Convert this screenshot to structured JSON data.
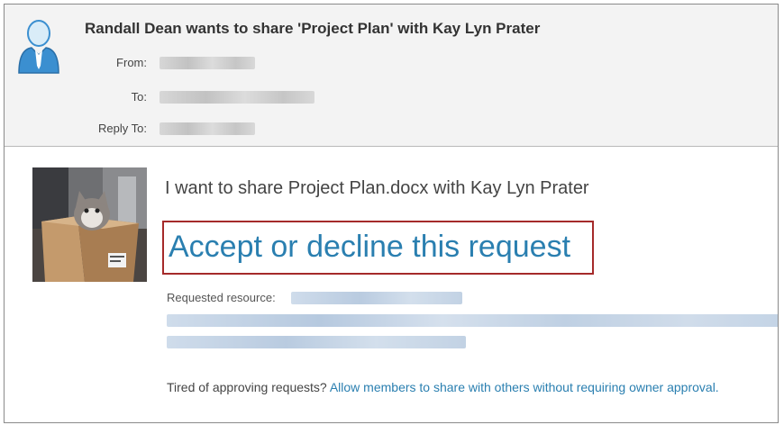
{
  "header": {
    "subject": "Randall Dean wants to share 'Project Plan' with Kay Lyn Prater",
    "from_label": "From:",
    "to_label": "To:",
    "reply_to_label": "Reply To:"
  },
  "body": {
    "message": "I want to share Project Plan.docx with Kay Lyn Prater",
    "accept_link": "Accept or decline this request",
    "requested_resource_label": "Requested resource:",
    "tired_text": "Tired of approving requests?",
    "allow_link": "Allow members to share with others without requiring owner approval."
  },
  "colors": {
    "link": "#2a7fb0",
    "highlight_border": "#a52a2a",
    "header_bg": "#f3f3f3"
  },
  "icons": {
    "avatar": "person-silhouette-icon",
    "photo": "cat-in-box-photo"
  }
}
